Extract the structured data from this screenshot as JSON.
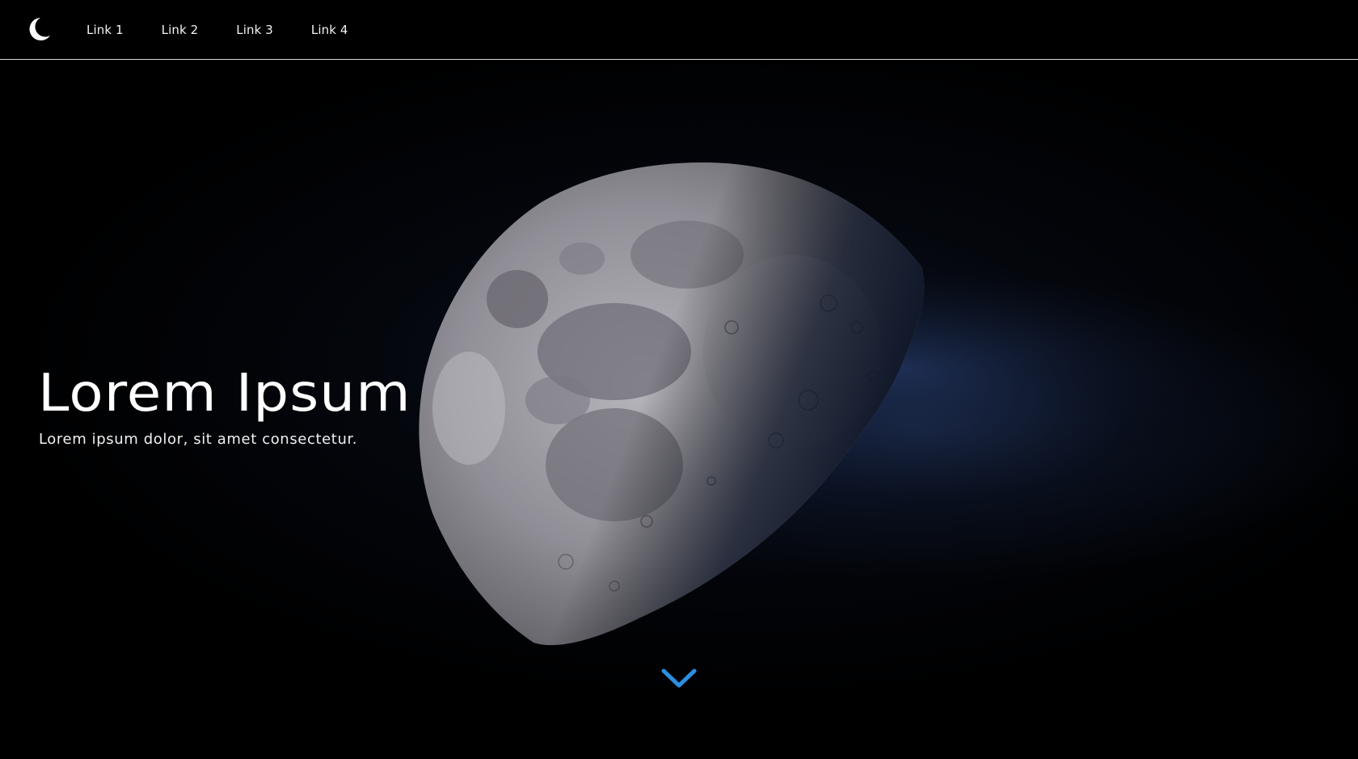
{
  "navbar": {
    "logo_icon": "crescent-moon-icon",
    "links": [
      {
        "label": "Link 1"
      },
      {
        "label": "Link 2"
      },
      {
        "label": "Link 3"
      },
      {
        "label": "Link 4"
      }
    ]
  },
  "hero": {
    "title": "Lorem Ipsum",
    "subtitle": "Lorem ipsum dolor, sit amet consectetur.",
    "background_image": "half-moon-photo",
    "scroll_icon": "chevron-down-icon"
  },
  "colors": {
    "background": "#000000",
    "text": "#ffffff",
    "accent": "#2b8fe0",
    "nav_divider": "#d9d9d9"
  }
}
